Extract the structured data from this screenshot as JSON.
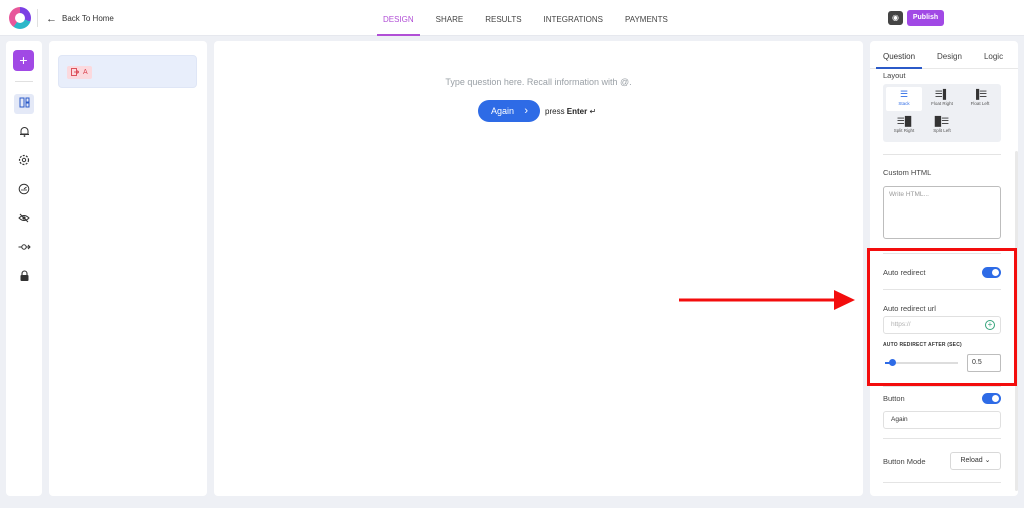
{
  "topbar": {
    "back_label": "Back To Home",
    "tabs": [
      {
        "label": "DESIGN",
        "active": true
      },
      {
        "label": "SHARE",
        "active": false
      },
      {
        "label": "RESULTS",
        "active": false
      },
      {
        "label": "INTEGRATIONS",
        "active": false
      },
      {
        "label": "PAYMENTS",
        "active": false
      }
    ],
    "publish_label": "Publish",
    "preview_icon": "eye-icon"
  },
  "rail": {
    "add_icon": "plus-icon",
    "icons": [
      "layout-icon",
      "bell-icon",
      "gear-icon",
      "gauge-icon",
      "eye-off-icon",
      "connection-icon",
      "lock-icon"
    ]
  },
  "question_list": {
    "items": [
      {
        "badge": "A",
        "icon": "exit-icon"
      }
    ]
  },
  "canvas": {
    "prompt": "Type question here. Recall information with @.",
    "button_label": "Again",
    "press_label": "press",
    "enter_label": "Enter"
  },
  "panel": {
    "tabs": [
      "Question",
      "Design",
      "Logic"
    ],
    "active_tab": "Question",
    "layout_label": "Layout",
    "layout_options": [
      "Stack",
      "Float Right",
      "Float Left",
      "Split Right",
      "Split Left"
    ],
    "selected_layout": "Stack",
    "custom_html_label": "Custom HTML",
    "custom_html_placeholder": "Write HTML...",
    "auto_redirect_label": "Auto redirect",
    "auto_redirect_on": true,
    "auto_redirect_url_label": "Auto redirect url",
    "auto_redirect_url_placeholder": "https://",
    "auto_redirect_after_label": "AUTO REDIRECT AFTER (SEC)",
    "auto_redirect_after_value": "0.5",
    "slider_fraction": 0.1,
    "button_label": "Button",
    "button_on": true,
    "button_text": "Again",
    "button_mode_label": "Button Mode",
    "button_mode_value": "Reload"
  },
  "colors": {
    "accent_purple": "#a149e5",
    "primary_blue": "#2e6be6",
    "annotation_red": "#f30d0d"
  }
}
